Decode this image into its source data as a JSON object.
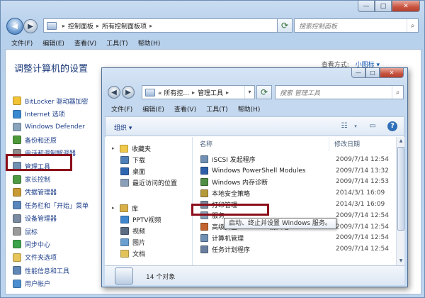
{
  "outer": {
    "caption_buttons": [
      "—",
      "□",
      "✕"
    ],
    "address": {
      "parts": [
        "控制面板",
        "所有控制面板项"
      ]
    },
    "search_placeholder": "搜索控制面板",
    "menu": [
      "文件(F)",
      "编辑(E)",
      "查看(V)",
      "工具(T)",
      "帮助(H)"
    ],
    "heading": "调整计算机的设置",
    "view_by_label": "查看方式:",
    "view_by_value": "小图标 ▾",
    "items": [
      {
        "label": "BitLocker 驱动器加密",
        "color": "#f2c335"
      },
      {
        "label": "Internet 选项",
        "color": "#3a89d0"
      },
      {
        "label": "Windows Defender",
        "color": "#8aa4bb"
      },
      {
        "label": "备份和还原",
        "color": "#4e9a3a"
      },
      {
        "label": "电话和调制解调器",
        "color": "#8c8c8c"
      },
      {
        "label": "管理工具",
        "color": "#6f8fb3"
      },
      {
        "label": "家长控制",
        "color": "#4d9a43"
      },
      {
        "label": "凭据管理器",
        "color": "#c89a35"
      },
      {
        "label": "任务栏和「开始」菜单",
        "color": "#5b86bd"
      },
      {
        "label": "设备管理器",
        "color": "#7a8aa0"
      },
      {
        "label": "鼠标",
        "color": "#9a9a9a"
      },
      {
        "label": "同步中心",
        "color": "#3ca34b"
      },
      {
        "label": "文件夹选项",
        "color": "#e6c55a"
      },
      {
        "label": "性能信息和工具",
        "color": "#5f86b4"
      },
      {
        "label": "用户帐户",
        "color": "#4b8fd0"
      }
    ]
  },
  "inner": {
    "caption_buttons": [
      "—",
      "□",
      "✕"
    ],
    "address": {
      "parts": [
        "« 所有控...",
        "管理工具"
      ]
    },
    "search_placeholder": "搜索 管理工具",
    "menu": [
      "文件(F)",
      "编辑(E)",
      "查看(V)",
      "工具(T)",
      "帮助(H)"
    ],
    "organize": "组织 ▾",
    "nav": [
      {
        "label": "收藏夹",
        "kind": "group",
        "color": "#f0c84b"
      },
      {
        "label": "下载",
        "kind": "item",
        "color": "#4f7fb8"
      },
      {
        "label": "桌面",
        "kind": "item",
        "color": "#2f66b0"
      },
      {
        "label": "最近访问的位置",
        "kind": "item",
        "color": "#8aa0b8"
      },
      {
        "label": "库",
        "kind": "group",
        "color": "#d9b04a"
      },
      {
        "label": "PPTV视频",
        "kind": "item",
        "color": "#3f86cf"
      },
      {
        "label": "视频",
        "kind": "item",
        "color": "#5a6b82"
      },
      {
        "label": "图片",
        "kind": "item",
        "color": "#6aa0cf"
      },
      {
        "label": "文档",
        "kind": "item",
        "color": "#e2c35a"
      }
    ],
    "columns": {
      "name": "名称",
      "date": "修改日期"
    },
    "files": [
      {
        "name": "iSCSI 发起程序",
        "date": "2009/7/14 12:54",
        "color": "#6f8fb3"
      },
      {
        "name": "Windows PowerShell Modules",
        "date": "2009/7/14 13:32",
        "color": "#2f5fa8"
      },
      {
        "name": "Windows 内存诊断",
        "date": "2009/7/14 12:53",
        "color": "#4e8f45"
      },
      {
        "name": "本地安全策略",
        "date": "2014/3/1 16:09",
        "color": "#b59a3a"
      },
      {
        "name": "打印管理",
        "date": "2014/3/1 16:09",
        "color": "#7b8aa0"
      },
      {
        "name": "服务",
        "date": "2009/7/14 12:54",
        "color": "#8aa0b8"
      },
      {
        "name": "高级安全 Windows 防火墙",
        "date": "2009/7/14 12:54",
        "color": "#c3632f"
      },
      {
        "name": "计算机管理",
        "date": "2009/7/14 12:54",
        "color": "#6f8fb3"
      },
      {
        "name": "任务计划程序",
        "date": "2009/7/14 12:54",
        "color": "#6a7fa0"
      }
    ],
    "tooltip": "启动、终止并设置 Windows 服务。",
    "details_text": "14 个对象"
  }
}
